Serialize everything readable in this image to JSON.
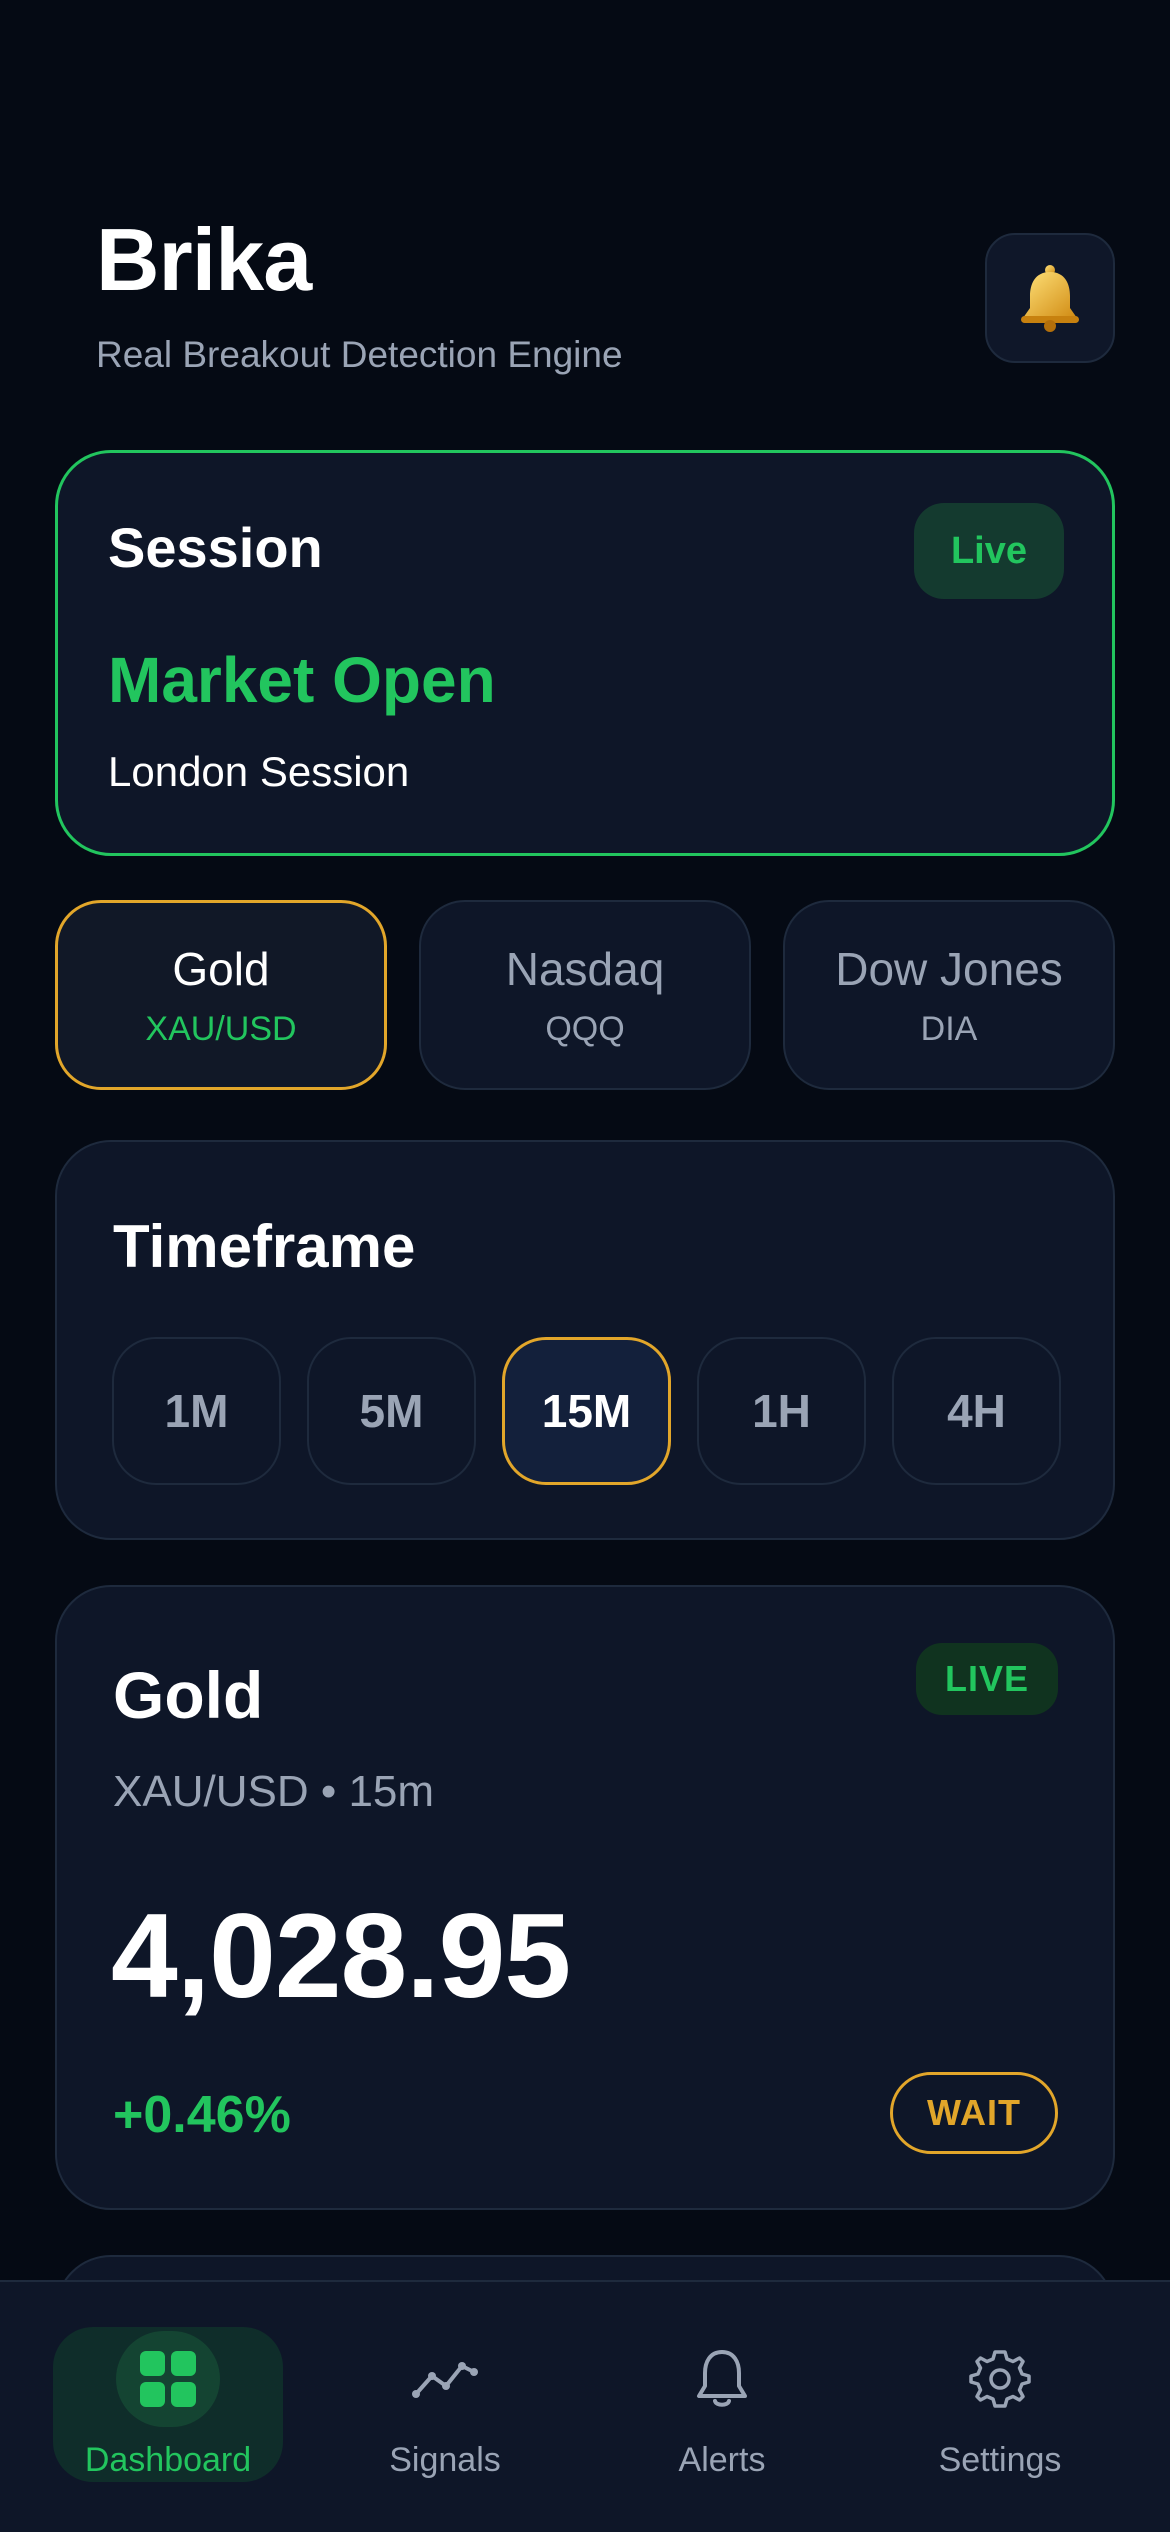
{
  "header": {
    "title": "Brika",
    "subtitle": "Real Breakout Detection Engine",
    "notification_icon": "bell-icon"
  },
  "session": {
    "title": "Session",
    "badge": "Live",
    "status": "Market Open",
    "name": "London Session"
  },
  "instruments": [
    {
      "name": "Gold",
      "symbol": "XAU/USD",
      "active": true
    },
    {
      "name": "Nasdaq",
      "symbol": "QQQ",
      "active": false
    },
    {
      "name": "Dow Jones",
      "symbol": "DIA",
      "active": false
    }
  ],
  "timeframe": {
    "title": "Timeframe",
    "options": [
      "1M",
      "5M",
      "15M",
      "1H",
      "4H"
    ],
    "selected": "15M"
  },
  "price_card": {
    "name": "Gold",
    "badge": "LIVE",
    "subtitle": "XAU/USD • 15m",
    "price": "4,028.95",
    "change": "+0.46%",
    "signal": "WAIT"
  },
  "nav": {
    "items": [
      {
        "label": "Dashboard",
        "icon": "dashboard-grid-icon",
        "active": true
      },
      {
        "label": "Signals",
        "icon": "signals-line-icon",
        "active": false
      },
      {
        "label": "Alerts",
        "icon": "bell-outline-icon",
        "active": false
      },
      {
        "label": "Settings",
        "icon": "gear-icon",
        "active": false
      }
    ]
  },
  "colors": {
    "background": "#050a14",
    "card": "#0e1628",
    "accent_green": "#22c55e",
    "accent_gold": "#e2a62a",
    "muted_text": "#9aa4b5"
  }
}
